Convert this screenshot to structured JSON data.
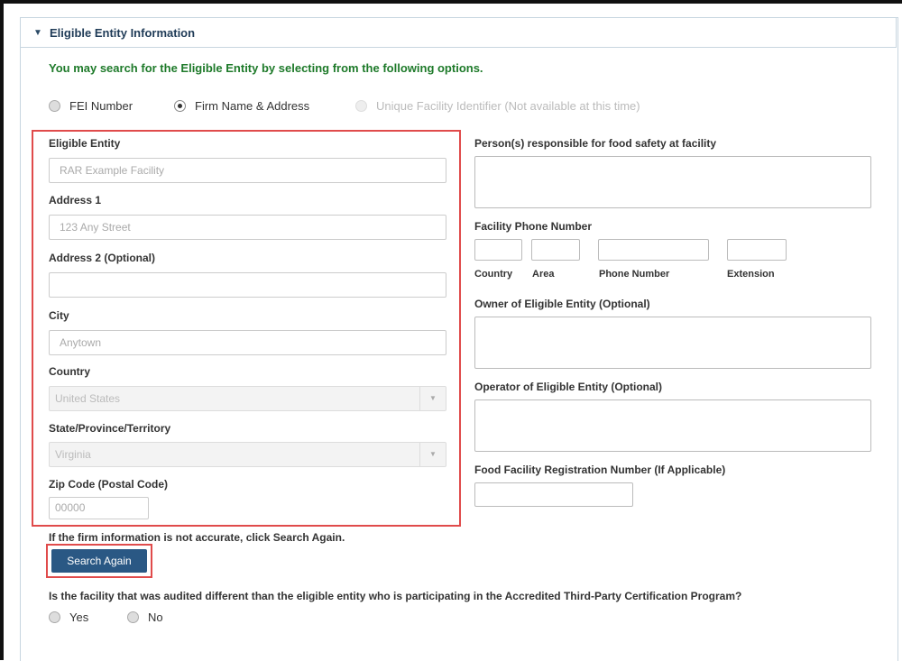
{
  "panel": {
    "title": "Eligible Entity Information",
    "hint": "You may search for the Eligible Entity by selecting from the following options."
  },
  "search_options": [
    {
      "label": "FEI Number",
      "state": "unchecked"
    },
    {
      "label": "Firm Name & Address",
      "state": "checked"
    },
    {
      "label": "Unique Facility Identifier (Not available at this time)",
      "state": "disabled"
    }
  ],
  "left": {
    "entity_label": "Eligible Entity",
    "entity_value": "RAR Example Facility",
    "addr1_label": "Address 1",
    "addr1_value": "123 Any Street",
    "addr2_label": "Address 2 (Optional)",
    "addr2_value": "",
    "city_label": "City",
    "city_value": "Anytown",
    "country_label": "Country",
    "country_value": "United States",
    "state_label": "State/Province/Territory",
    "state_value": "Virginia",
    "zip_label": "Zip Code (Postal Code)",
    "zip_value": "00000"
  },
  "right": {
    "persons_label": "Person(s) responsible for food safety at facility",
    "phone_label": "Facility Phone Number",
    "phone_parts": {
      "country": "Country",
      "area": "Area",
      "number": "Phone Number",
      "extension": "Extension"
    },
    "owner_label": "Owner of Eligible Entity (Optional)",
    "operator_label": "Operator of Eligible Entity (Optional)",
    "ffr_label": "Food Facility Registration Number (If Applicable)"
  },
  "search_again": {
    "note": "If the firm information is not accurate, click Search Again.",
    "button": "Search Again"
  },
  "audit_question": {
    "text": "Is the facility that was audited different than the eligible entity who is participating in the Accredited Third-Party Certification Program?",
    "yes": "Yes",
    "no": "No"
  }
}
